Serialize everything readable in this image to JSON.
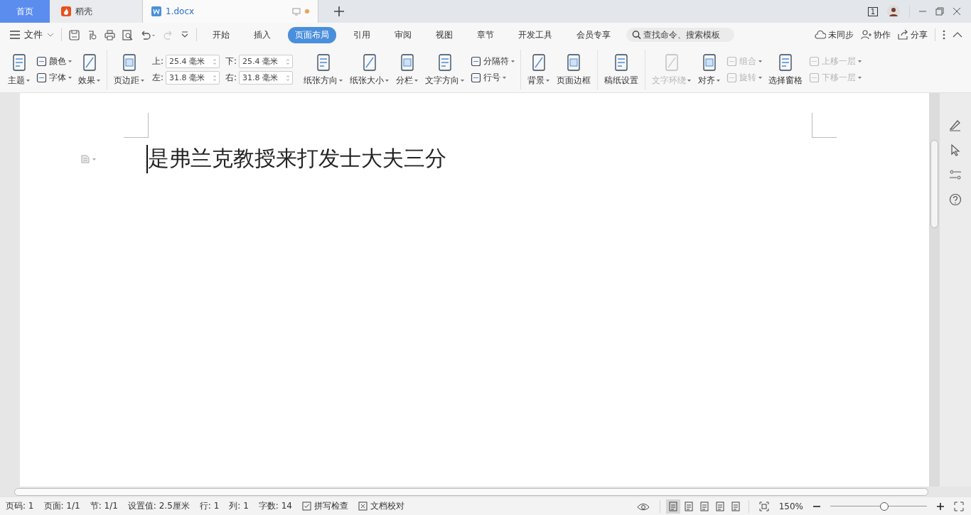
{
  "tabs": [
    {
      "kind": "home",
      "label": "首页",
      "selected": false
    },
    {
      "kind": "app",
      "label": "稻壳",
      "selected": false
    },
    {
      "kind": "doc",
      "label": "1.docx",
      "selected": true
    }
  ],
  "title_bar": {
    "page_badge": "1"
  },
  "menu": {
    "file": "文件",
    "ribbon_tabs": [
      {
        "label": "开始",
        "selected": false
      },
      {
        "label": "插入",
        "selected": false
      },
      {
        "label": "页面布局",
        "selected": true
      },
      {
        "label": "引用",
        "selected": false
      },
      {
        "label": "审阅",
        "selected": false
      },
      {
        "label": "视图",
        "selected": false
      },
      {
        "label": "章节",
        "selected": false
      },
      {
        "label": "开发工具",
        "selected": false
      },
      {
        "label": "会员专享",
        "selected": false
      }
    ],
    "search": {
      "placeholder": "查找命令、搜索模板"
    },
    "actions": [
      "未同步",
      "协作",
      "分享"
    ]
  },
  "ribbon": {
    "groups": [
      {
        "items": [
          {
            "kind": "big",
            "label": "主题",
            "dropdown": true,
            "disabled": false
          },
          {
            "kind": "stack",
            "items": [
              {
                "label": "颜色",
                "dropdown": true,
                "disabled": false
              },
              {
                "label": "字体",
                "dropdown": true,
                "disabled": false
              }
            ]
          },
          {
            "kind": "big",
            "label": "效果",
            "dropdown": true,
            "disabled": false
          }
        ]
      },
      {
        "items": [
          {
            "kind": "big",
            "label": "页边距",
            "dropdown": true,
            "disabled": false
          },
          {
            "kind": "margins",
            "fields": [
              {
                "label": "上:",
                "value": "25.4 毫米"
              },
              {
                "label": "下:",
                "value": "25.4 毫米"
              },
              {
                "label": "左:",
                "value": "31.8 毫米"
              },
              {
                "label": "右:",
                "value": "31.8 毫米"
              }
            ]
          },
          {
            "kind": "big",
            "label": "纸张方向",
            "dropdown": true,
            "disabled": false
          },
          {
            "kind": "big",
            "label": "纸张大小",
            "dropdown": true,
            "disabled": false
          },
          {
            "kind": "big",
            "label": "分栏",
            "dropdown": true,
            "disabled": false
          },
          {
            "kind": "big",
            "label": "文字方向",
            "dropdown": true,
            "disabled": false
          },
          {
            "kind": "stack",
            "items": [
              {
                "label": "分隔符",
                "dropdown": true,
                "disabled": false
              },
              {
                "label": "行号",
                "dropdown": true,
                "disabled": false
              }
            ]
          }
        ]
      },
      {
        "items": [
          {
            "kind": "big",
            "label": "背景",
            "dropdown": true,
            "disabled": false
          },
          {
            "kind": "big",
            "label": "页面边框",
            "dropdown": false,
            "disabled": false
          }
        ]
      },
      {
        "items": [
          {
            "kind": "big",
            "label": "稿纸设置",
            "dropdown": false,
            "disabled": false
          }
        ]
      },
      {
        "items": [
          {
            "kind": "big",
            "label": "文字环绕",
            "dropdown": true,
            "disabled": true
          },
          {
            "kind": "big",
            "label": "对齐",
            "dropdown": true,
            "disabled": false
          },
          {
            "kind": "stack",
            "items": [
              {
                "label": "组合",
                "dropdown": true,
                "disabled": true
              },
              {
                "label": "旋转",
                "dropdown": true,
                "disabled": true
              }
            ]
          },
          {
            "kind": "big",
            "label": "选择窗格",
            "dropdown": false,
            "disabled": false
          },
          {
            "kind": "stack",
            "items": [
              {
                "label": "上移一层",
                "dropdown": true,
                "disabled": true
              },
              {
                "label": "下移一层",
                "dropdown": true,
                "disabled": true
              }
            ]
          }
        ]
      }
    ]
  },
  "document": {
    "text": "是弗兰克教授来打发士大夫三分"
  },
  "status_bar": {
    "items": [
      {
        "kind": "text",
        "label": "页码: 1"
      },
      {
        "kind": "text",
        "label": "页面: 1/1"
      },
      {
        "kind": "text",
        "label": "节: 1/1"
      },
      {
        "kind": "text",
        "label": "设置值: 2.5厘米"
      },
      {
        "kind": "text",
        "label": "行: 1"
      },
      {
        "kind": "text",
        "label": "列: 1"
      },
      {
        "kind": "text",
        "label": "字数: 14"
      },
      {
        "kind": "check",
        "label": "拼写检查"
      },
      {
        "kind": "cross",
        "label": "文档校对"
      }
    ],
    "views": [
      {
        "selected": true
      },
      {
        "selected": false
      },
      {
        "selected": false
      },
      {
        "selected": false
      },
      {
        "selected": false
      }
    ],
    "zoom": "150%",
    "zoom_slider": {
      "level": 0.56
    }
  }
}
